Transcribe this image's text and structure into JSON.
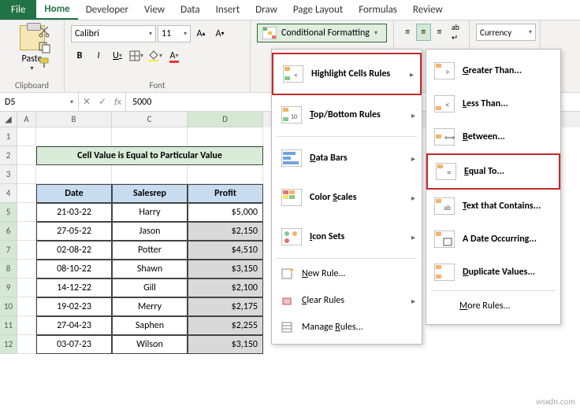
{
  "tabs": {
    "file": "File",
    "list": [
      "Home",
      "Developer",
      "View",
      "Data",
      "Insert",
      "Draw",
      "Page Layout",
      "Formulas",
      "Review"
    ],
    "active": "Home"
  },
  "ribbon": {
    "clipboard": {
      "paste": "Paste",
      "label": "Clipboard"
    },
    "font": {
      "name": "Calibri",
      "size": "11",
      "label": "Font"
    },
    "cf_button": "Conditional Formatting",
    "currency": "Currency"
  },
  "namebox": "D5",
  "fx_value": "5000",
  "sheet": {
    "title": "Cell Value is Equal to Particular Value",
    "headers": [
      "Date",
      "Salesrep",
      "Profit"
    ],
    "rows": [
      {
        "date": "21-03-22",
        "rep": "Harry",
        "profit": "$5,000",
        "white": true
      },
      {
        "date": "27-05-22",
        "rep": "Jason",
        "profit": "$2,150"
      },
      {
        "date": "02-08-22",
        "rep": "Potter",
        "profit": "$4,510"
      },
      {
        "date": "08-10-22",
        "rep": "Shawn",
        "profit": "$3,150"
      },
      {
        "date": "14-12-22",
        "rep": "Gill",
        "profit": "$2,100"
      },
      {
        "date": "19-02-23",
        "rep": "Merry",
        "profit": "$2,175"
      },
      {
        "date": "27-04-23",
        "rep": "Saphen",
        "profit": "$2,255"
      },
      {
        "date": "03-07-23",
        "rep": "Wilson",
        "profit": "$3,150"
      }
    ]
  },
  "col_letters": [
    "A",
    "B",
    "C",
    "D"
  ],
  "row_nums": [
    "1",
    "2",
    "3",
    "4",
    "5",
    "6",
    "7",
    "8",
    "9",
    "10",
    "11",
    "12"
  ],
  "menu1": {
    "highlight": "Highlight Cells Rules",
    "topbottom": "Top/Bottom Rules",
    "databars": "Data Bars",
    "colorscales": "Color Scales",
    "iconsets": "Icon Sets",
    "new": "New Rule...",
    "clear": "Clear Rules",
    "manage": "Manage Rules..."
  },
  "menu2": {
    "greater": "Greater Than...",
    "less": "Less Than...",
    "between": "Between...",
    "equal": "Equal To...",
    "contains": "Text that Contains...",
    "date": "A Date Occurring...",
    "dup": "Duplicate Values...",
    "more": "More Rules..."
  },
  "watermark": "wsxdn.com"
}
